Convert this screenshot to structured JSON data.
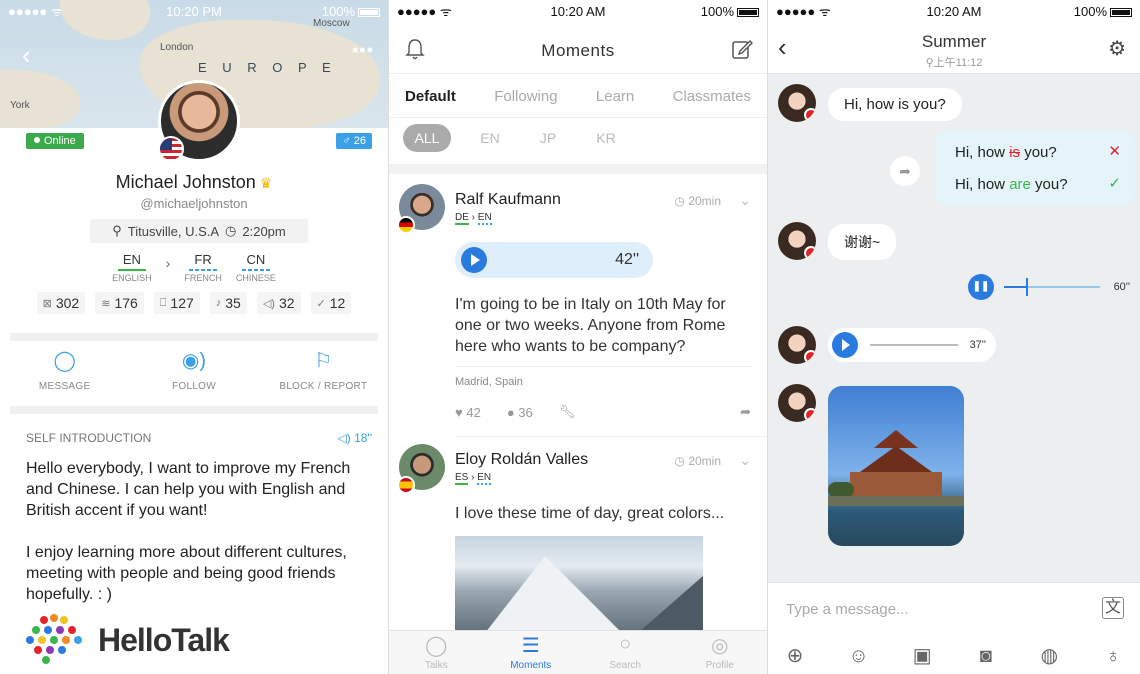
{
  "profile": {
    "status": {
      "carrier": "●●●●● ᯤ",
      "time": "10:20 PM",
      "battery": "100%"
    },
    "map": {
      "europe": "E U R O P E",
      "london": "London",
      "moscow": "Moscow",
      "york": "York"
    },
    "online": "Online",
    "age_badge": "♂ 26",
    "name": "Michael Johnston",
    "handle": "@michaeljohnston",
    "location": "Titusville, U.S.A",
    "local_time": "2:20pm",
    "native": {
      "code": "EN",
      "full": "ENGLISH"
    },
    "learning": [
      {
        "code": "FR",
        "full": "FRENCH"
      },
      {
        "code": "CN",
        "full": "CHINESE"
      }
    ],
    "stats": [
      "302",
      "176",
      "127",
      "35",
      "32",
      "12"
    ],
    "actions": {
      "message": "MESSAGE",
      "follow": "FOLLOW",
      "block": "BLOCK / REPORT"
    },
    "intro_heading": "SELF INTRODUCTION",
    "intro_audio": "18''",
    "intro_text": "Hello everybody, I want to improve my French and Chinese. I can help you with English and British accent if you want!\n\nI enjoy learning more about different cultures, meeting with people and being good friends hopefully. : )",
    "logo": "HelloTalk"
  },
  "moments": {
    "status": {
      "carrier": "●●●●● ᯤ",
      "time": "10:20 AM",
      "battery": "100%"
    },
    "title": "Moments",
    "tabs": [
      "Default",
      "Following",
      "Learn",
      "Classmates"
    ],
    "filters": [
      "ALL",
      "EN",
      "JP",
      "KR"
    ],
    "posts": [
      {
        "name": "Ralf Kaufmann",
        "from": "DE",
        "to": "EN",
        "time": "20min",
        "voice": "42''",
        "text": "I'm going to be in Italy on 10th May for one or two weeks. Anyone from Rome here who wants to be company?",
        "location": "Madrid, Spain",
        "likes": "42",
        "comments": "36"
      },
      {
        "name": "Eloy Roldán Valles",
        "from": "ES",
        "to": "EN",
        "time": "20min",
        "text": "I love these time of day, great colors..."
      }
    ],
    "tabbar": [
      "Talks",
      "Moments",
      "Search",
      "Profile"
    ]
  },
  "chat": {
    "status": {
      "carrier": "●●●●● ᯤ",
      "time": "10:20 AM",
      "battery": "100%"
    },
    "title": "Summer",
    "subtitle": "上午11:12",
    "msg1": "Hi, how is you?",
    "corr_pre": "Hi, how ",
    "corr_wrong": "is",
    "corr_right": "are",
    "corr_post": " you?",
    "msg3": "谢谢~",
    "audio_out": "60''",
    "audio_in": "37''",
    "input_placeholder": "Type a message..."
  }
}
